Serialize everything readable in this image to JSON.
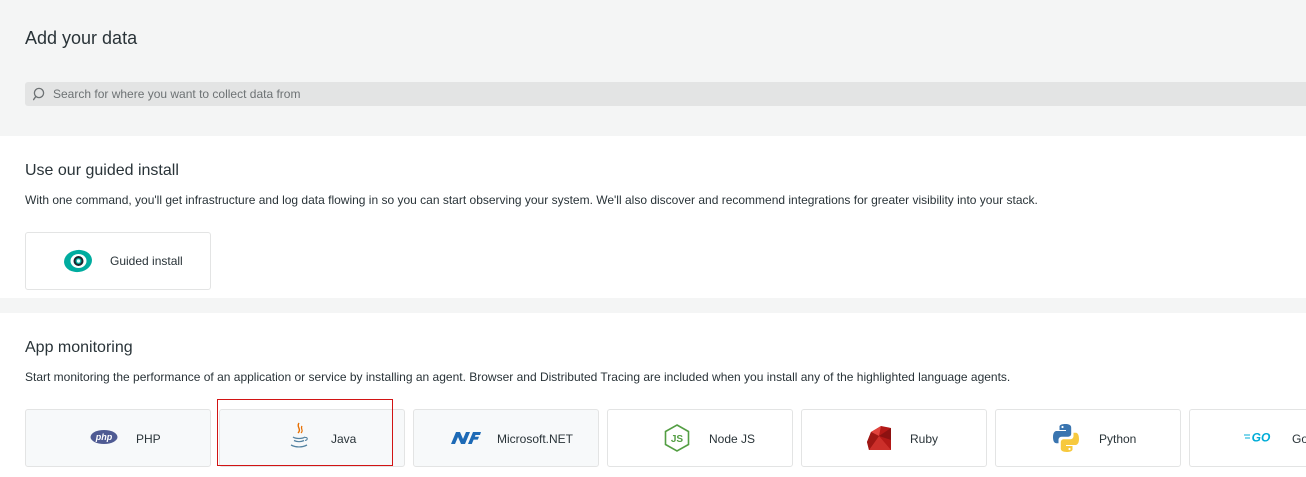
{
  "page": {
    "title": "Add your data",
    "search_placeholder": "Search for where you want to collect data from",
    "search_value": ""
  },
  "guided": {
    "title": "Use our guided install",
    "description": "With one command, you'll get infrastructure and log data flowing in so you can start observing your system. We'll also discover and recommend integrations for greater visibility into your stack.",
    "tile_label": "Guided install"
  },
  "app": {
    "title": "App monitoring",
    "description": "Start monitoring the performance of an application or service by installing an agent. Browser and Distributed Tracing are included when you install any of the highlighted language agents.",
    "agents": [
      {
        "label": "PHP",
        "icon": "php-icon",
        "icon_text": "php",
        "highlighted": true
      },
      {
        "label": "Java",
        "icon": "java-icon",
        "highlighted": true,
        "selected": true
      },
      {
        "label": "Microsoft.NET",
        "icon": "dotnet-icon",
        "highlighted": true
      },
      {
        "label": "Node JS",
        "icon": "nodejs-icon",
        "icon_text": "JS",
        "highlighted": false
      },
      {
        "label": "Ruby",
        "icon": "ruby-icon",
        "highlighted": false
      },
      {
        "label": "Python",
        "icon": "python-icon",
        "highlighted": false
      },
      {
        "label": "Go",
        "icon": "go-icon",
        "icon_text": "GO",
        "highlighted": false
      }
    ]
  },
  "colors": {
    "background": "#f4f5f5",
    "panel": "#ffffff",
    "search_bg": "#e3e4e4",
    "text": "#293338",
    "guided_icon": "#00ac9f",
    "selection_outline": "#d21414"
  }
}
